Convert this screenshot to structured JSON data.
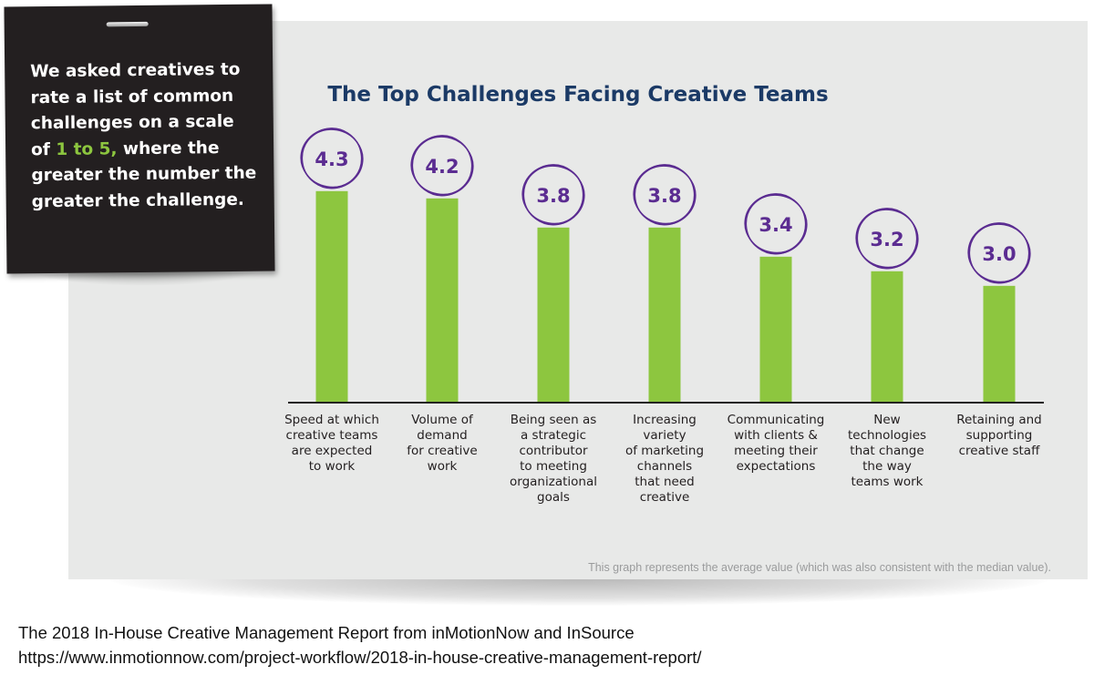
{
  "note": {
    "line_parts": [
      "We asked creatives to rate a list of common challenges on a scale of ",
      "1 to 5,",
      " where the greater the number the greater the challenge."
    ]
  },
  "footnote": "This graph represents the average value (which was also consistent with the median value).",
  "source": {
    "line1": "The 2018 In-House Creative Management Report from inMotionNow and InSource",
    "line2": "https://www.inmotionnow.com/project-workflow/2018-in-house-creative-management-report/"
  },
  "colors": {
    "bar": "#8dc63f",
    "circle": "#5b2c91",
    "title": "#1b3a66",
    "panel": "#e8e9e8",
    "highlight": "#8dc63f"
  },
  "chart_data": {
    "type": "bar",
    "title": "The Top Challenges Facing Creative Teams",
    "xlabel": "",
    "ylabel": "",
    "scale": [
      1,
      5
    ],
    "categories": [
      "Speed at which creative teams are expected to work",
      "Volume of demand for creative work",
      "Being seen as a strategic contributor to meeting organizational goals",
      "Increasing variety of marketing channels that need creative",
      "Communicating with clients & meeting their expectations",
      "New technologies that change the way teams work",
      "Retaining and supporting creative staff"
    ],
    "category_lines": [
      [
        "Speed at which",
        "creative teams",
        "are expected",
        "to work"
      ],
      [
        "Volume of",
        "demand",
        "for creative",
        "work"
      ],
      [
        "Being seen as",
        "a strategic",
        "contributor",
        "to meeting",
        "organizational",
        "goals"
      ],
      [
        "Increasing",
        "variety",
        "of marketing",
        "channels",
        "that need",
        "creative"
      ],
      [
        "Communicating",
        "with clients &",
        "meeting their",
        "expectations"
      ],
      [
        "New",
        "technologies",
        "that change",
        "the way",
        "teams work"
      ],
      [
        "Retaining and",
        "supporting",
        "creative staff"
      ]
    ],
    "values": [
      4.3,
      4.2,
      3.8,
      3.8,
      3.4,
      3.2,
      3.0
    ],
    "data_labels": [
      "4.3",
      "4.2",
      "3.8",
      "3.8",
      "3.4",
      "3.2",
      "3.0"
    ],
    "grid": false,
    "legend": "none"
  }
}
